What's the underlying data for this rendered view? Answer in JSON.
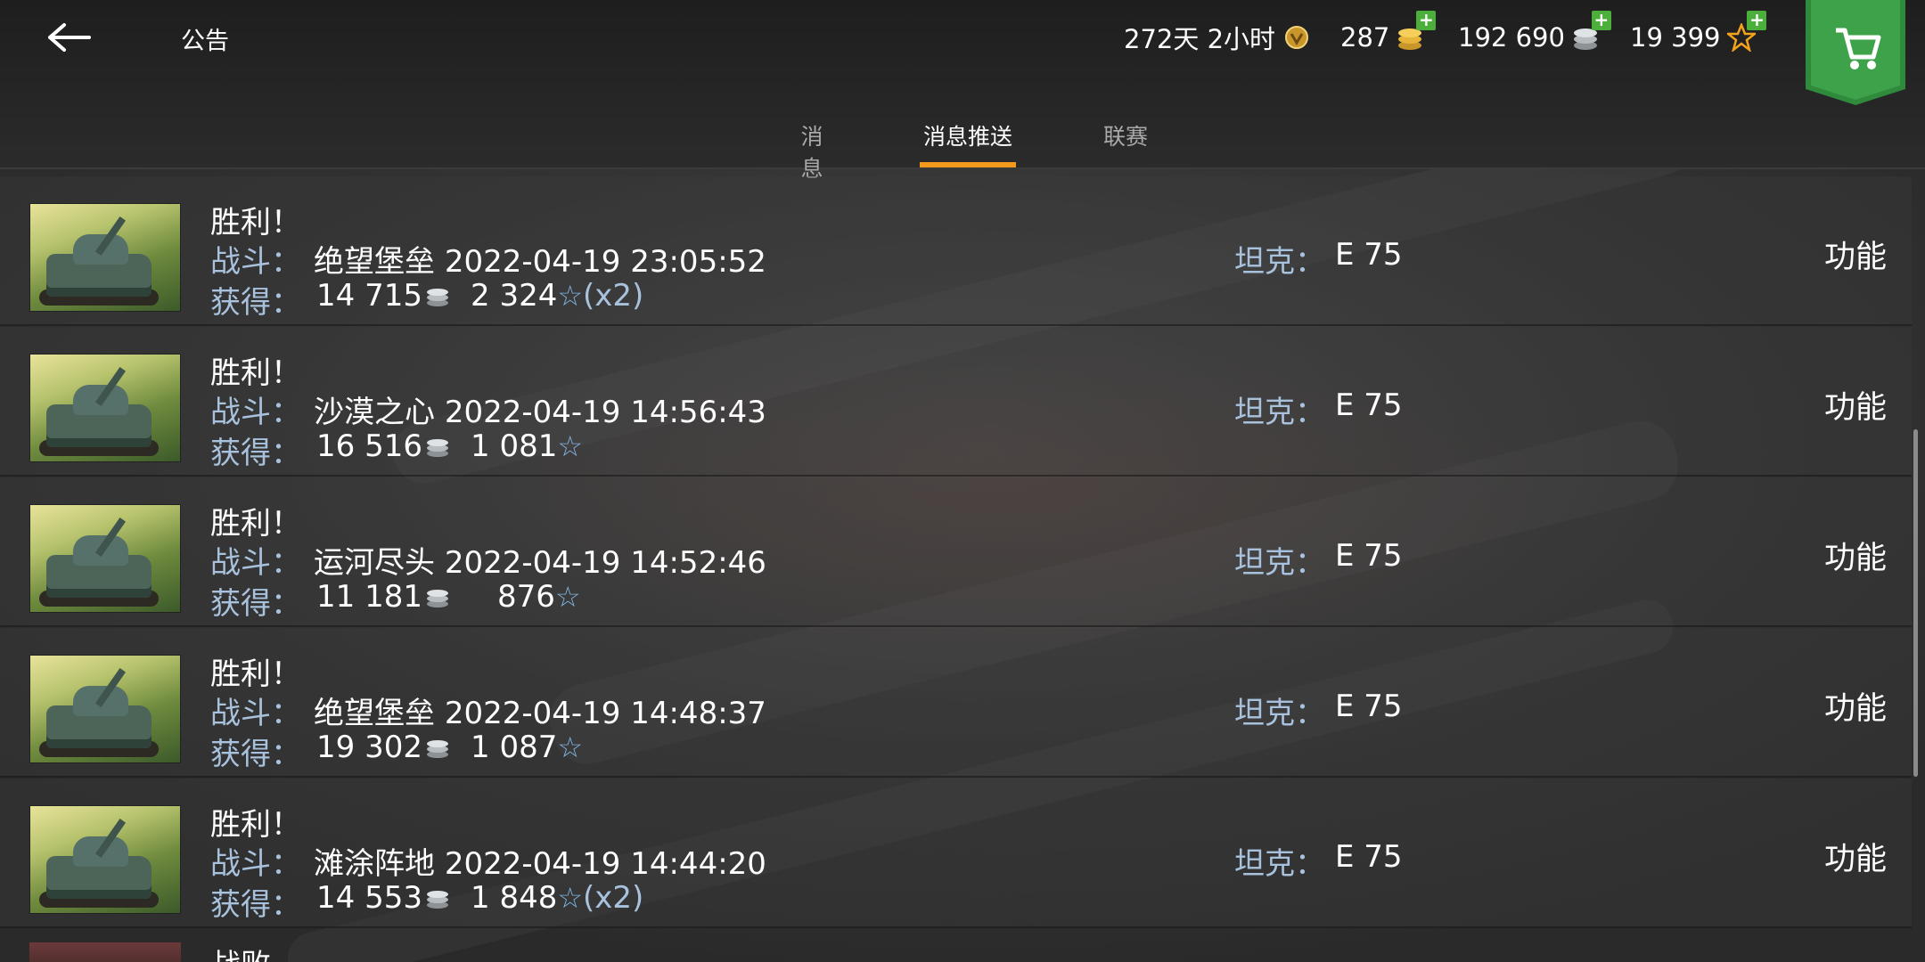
{
  "header": {
    "title": "公告",
    "stats": {
      "premium_time": "272天 2小时",
      "gold": "287",
      "credits": "192 690",
      "free_xp": "19 399"
    }
  },
  "tabs": [
    {
      "label": "消息",
      "active": false
    },
    {
      "label": "消息推送",
      "active": true
    },
    {
      "label": "联赛",
      "active": false
    }
  ],
  "labels": {
    "battle": "战斗：",
    "earned": "获得：",
    "tank": "坦克：",
    "function": "功能"
  },
  "messages": [
    {
      "result": "胜利！",
      "map": "绝望堡垒",
      "datetime": "2022-04-19 23:05:52",
      "credits": "14 715",
      "xp": "2 324",
      "multiplier": "(x2)",
      "tank": "E 75"
    },
    {
      "result": "胜利！",
      "map": "沙漠之心",
      "datetime": "2022-04-19 14:56:43",
      "credits": "16 516",
      "xp": "1 081",
      "multiplier": "",
      "tank": "E 75"
    },
    {
      "result": "胜利！",
      "map": "运河尽头",
      "datetime": "2022-04-19 14:52:46",
      "credits": "11 181",
      "xp": "876",
      "multiplier": "",
      "tank": "E 75"
    },
    {
      "result": "胜利！",
      "map": "绝望堡垒",
      "datetime": "2022-04-19 14:48:37",
      "credits": "19 302",
      "xp": "1 087",
      "multiplier": "",
      "tank": "E 75"
    },
    {
      "result": "胜利！",
      "map": "滩涂阵地",
      "datetime": "2022-04-19 14:44:20",
      "credits": "14 553",
      "xp": "1 848",
      "multiplier": "(x2)",
      "tank": "E 75"
    }
  ],
  "partial_message": {
    "result": "战败"
  },
  "colors": {
    "accent": "#f39a1c",
    "label_blue": "#a8c2dd",
    "add_green": "#4caf3c",
    "gold": "#e7b53a"
  }
}
